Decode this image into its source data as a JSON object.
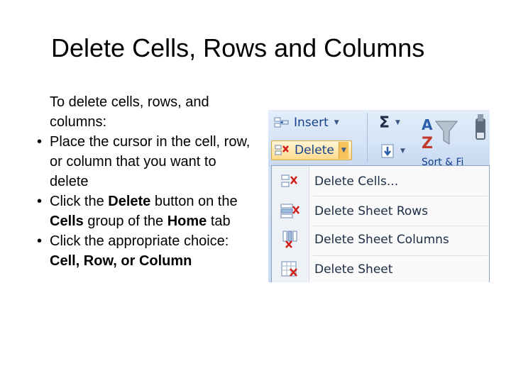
{
  "slide": {
    "title": "Delete Cells, Rows and Columns",
    "intro": "To delete cells, rows, and columns:",
    "bullets": [
      {
        "parts": [
          "Place the cursor in the cell, row, or column that you want to delete"
        ]
      },
      {
        "parts": [
          "Click the ",
          "Delete",
          " button on the ",
          "Cells",
          " group of the ",
          "Home",
          " tab"
        ]
      },
      {
        "parts": [
          "Click the appropriate choice: ",
          "Cell, Row, or Column"
        ]
      }
    ],
    "bullet_glyph": "•"
  },
  "ribbon": {
    "insert_label": "Insert",
    "delete_label": "Delete",
    "sigma": "Σ",
    "sort_partial": "Sort & Fi",
    "dropdown_arrow": "▼"
  },
  "menu": {
    "items": [
      {
        "label": "Delete Cells...",
        "icon": "delete-cells-icon"
      },
      {
        "label": "Delete Sheet Rows",
        "icon": "delete-rows-icon"
      },
      {
        "label": "Delete Sheet Columns",
        "icon": "delete-columns-icon"
      },
      {
        "label": "Delete Sheet",
        "icon": "delete-sheet-icon"
      }
    ]
  },
  "colors": {
    "ribbon_text": "#15428b",
    "delete_red": "#d0201a",
    "highlight": "#ffd98c"
  }
}
